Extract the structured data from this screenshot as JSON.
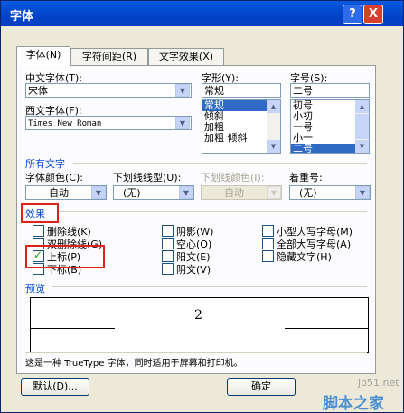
{
  "window": {
    "title": "字体",
    "help_label": "?",
    "close_label": "X"
  },
  "tabs": [
    {
      "label": "字体(N)"
    },
    {
      "label": "字符间距(R)"
    },
    {
      "label": "文字效果(X)"
    }
  ],
  "font": {
    "chinese_label": "中文字体(T):",
    "chinese_value": "宋体",
    "western_label": "西文字体(F):",
    "western_value": "Times New Roman",
    "style_label": "字形(Y):",
    "style_value": "常规",
    "style_options": [
      "常规",
      "倾斜",
      "加粗",
      "加粗 倾斜"
    ],
    "size_label": "字号(S):",
    "size_value": "二号",
    "size_options": [
      "初号",
      "小初",
      "一号",
      "小一",
      "二号"
    ]
  },
  "all_text": {
    "section": "所有文字",
    "color_label": "字体颜色(C):",
    "color_value": "自动",
    "underline_label": "下划线线型(U):",
    "underline_value": "(无)",
    "underline_color_label": "下划线颜色(I):",
    "underline_color_value": "自动",
    "emphasis_label": "着重号:",
    "emphasis_value": "(无)"
  },
  "effects": {
    "section": "效果",
    "items": [
      {
        "label": "删除线(K)",
        "checked": false
      },
      {
        "label": "双删除线(G)",
        "checked": false
      },
      {
        "label": "上标(P)",
        "checked": true
      },
      {
        "label": "下标(B)",
        "checked": false
      },
      {
        "label": "阴影(W)",
        "checked": false
      },
      {
        "label": "空心(O)",
        "checked": false
      },
      {
        "label": "阳文(E)",
        "checked": false
      },
      {
        "label": "阴文(V)",
        "checked": false
      },
      {
        "label": "小型大写字母(M)",
        "checked": false
      },
      {
        "label": "全部大写字母(A)",
        "checked": false
      },
      {
        "label": "隐藏文字(H)",
        "checked": false
      }
    ]
  },
  "preview": {
    "section": "预览",
    "sample": "2"
  },
  "info_text": "这是一种 TrueType 字体，同时适用于屏幕和打印机。",
  "buttons": {
    "default": "默认(D)...",
    "ok": "确定"
  },
  "watermark": {
    "line1": "jb51.net",
    "line2": "脚本之家"
  }
}
